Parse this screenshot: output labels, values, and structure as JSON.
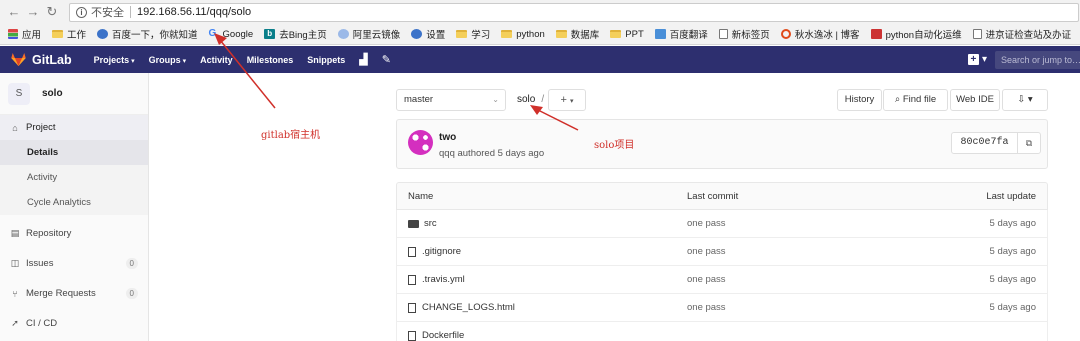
{
  "browser": {
    "insecure_label": "不安全",
    "url": "192.168.56.11/qqq/solo",
    "bookmarks": [
      {
        "label": "应用",
        "icon": "apps-icon"
      },
      {
        "label": "工作",
        "icon": "folder-icon"
      },
      {
        "label": "百度一下，你就知道",
        "icon": "baidu-icon"
      },
      {
        "label": "Google",
        "icon": "google-icon"
      },
      {
        "label": "去Bing主页",
        "icon": "bing-icon"
      },
      {
        "label": "阿里云镜像",
        "icon": "cloud-icon"
      },
      {
        "label": "设置",
        "icon": "gear-icon"
      },
      {
        "label": "学习",
        "icon": "folder-icon"
      },
      {
        "label": "python",
        "icon": "folder-icon"
      },
      {
        "label": "数据库",
        "icon": "folder-icon"
      },
      {
        "label": "PPT",
        "icon": "folder-icon"
      },
      {
        "label": "百度翻译",
        "icon": "translate-icon"
      },
      {
        "label": "新标签页",
        "icon": "page-icon"
      },
      {
        "label": "秋水逸冰 | 博客",
        "icon": "circle-icon"
      },
      {
        "label": "python自动化运维",
        "icon": "python-icon"
      },
      {
        "label": "进京证检查站及办证",
        "icon": "page-icon"
      }
    ]
  },
  "gitlab": {
    "brand": "GitLab",
    "nav": {
      "projects": "Projects",
      "groups": "Groups",
      "activity": "Activity",
      "milestones": "Milestones",
      "snippets": "Snippets"
    },
    "search_placeholder": "Search or jump to…"
  },
  "sidebar": {
    "avatar_letter": "S",
    "project_name": "solo",
    "project_label": "Project",
    "details": "Details",
    "activity": "Activity",
    "cycle_analytics": "Cycle Analytics",
    "repository": "Repository",
    "issues": "Issues",
    "issues_count": "0",
    "merge_requests": "Merge Requests",
    "merge_requests_count": "0",
    "cicd": "CI / CD"
  },
  "toolbar": {
    "branch": "master",
    "breadcrumb_project": "solo",
    "breadcrumb_sep": "/",
    "history": "History",
    "find_file": "Find file",
    "web_ide": "Web IDE"
  },
  "commit": {
    "title": "two",
    "meta": "qqq authored 5 days ago",
    "sha": "80c0e7fa"
  },
  "files": {
    "headers": {
      "name": "Name",
      "last_commit": "Last commit",
      "last_update": "Last update"
    },
    "rows": [
      {
        "name": "src",
        "type": "folder",
        "commit": "one pass",
        "updated": "5 days ago"
      },
      {
        "name": ".gitignore",
        "type": "file",
        "commit": "one pass",
        "updated": "5 days ago"
      },
      {
        "name": ".travis.yml",
        "type": "file",
        "commit": "one pass",
        "updated": "5 days ago"
      },
      {
        "name": "CHANGE_LOGS.html",
        "type": "file",
        "commit": "one pass",
        "updated": "5 days ago"
      },
      {
        "name": "Dockerfile",
        "type": "file",
        "commit": "",
        "updated": ""
      }
    ]
  },
  "annotations": {
    "host": "gitlab宿主机",
    "project": "solo项目"
  },
  "colors": {
    "header": "#2d2f6f",
    "annotation": "#d0302a"
  }
}
